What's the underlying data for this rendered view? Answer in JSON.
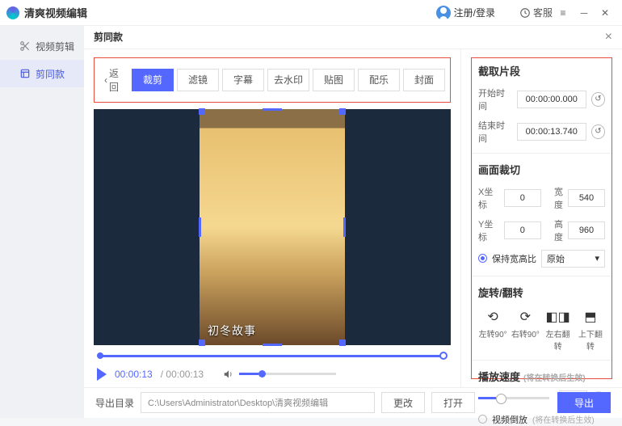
{
  "app": {
    "title": "清爽视频编辑"
  },
  "titlebar": {
    "login": "注册/登录",
    "service": "客服"
  },
  "sidebar": {
    "items": [
      {
        "label": "视频剪辑",
        "icon": "scissors-icon"
      },
      {
        "label": "剪同款",
        "icon": "template-icon"
      }
    ]
  },
  "panel": {
    "title": "剪同款",
    "back": "返回"
  },
  "tabs": [
    "裁剪",
    "滤镜",
    "字幕",
    "去水印",
    "贴图",
    "配乐",
    "封面"
  ],
  "preview": {
    "caption": "初冬故事"
  },
  "playback": {
    "current": "00:00:13",
    "total": "00:00:13"
  },
  "clip": {
    "title": "截取片段",
    "start_label": "开始时间",
    "start_value": "00:00:00.000",
    "end_label": "结束时间",
    "end_value": "00:00:13.740"
  },
  "crop": {
    "title": "画面裁切",
    "x_label": "X坐标",
    "x_value": "0",
    "y_label": "Y坐标",
    "y_value": "0",
    "w_label": "宽度",
    "w_value": "540",
    "h_label": "高度",
    "h_value": "960",
    "keep_ratio": "保持宽高比",
    "ratio_value": "原始"
  },
  "rotate": {
    "title": "旋转/翻转",
    "left90": "左转90°",
    "right90": "右转90°",
    "fliph": "左右翻转",
    "flipv": "上下翻转"
  },
  "speed": {
    "title": "播放速度",
    "hint": "(将在转换后生效)",
    "value": "1.0",
    "reverse": "视频倒放",
    "reverse_hint": "(将在转换后生效)"
  },
  "footer": {
    "label": "导出目录",
    "path": "C:\\Users\\Administrator\\Desktop\\清爽视频编辑",
    "change": "更改",
    "open": "打开",
    "export": "导出"
  }
}
